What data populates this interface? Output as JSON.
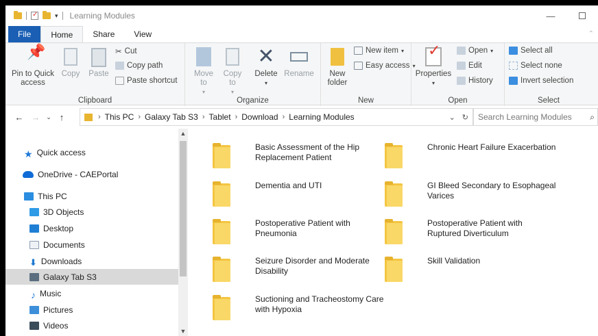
{
  "window": {
    "title": "Learning Modules",
    "controls": [
      "—",
      "☐"
    ]
  },
  "ribbon_tabs": [
    "File",
    "Home",
    "Share",
    "View"
  ],
  "clipboard": {
    "pin_label": "Pin to Quick access",
    "copy_label": "Copy",
    "paste_label": "Paste",
    "cut_label": "Cut",
    "copy_path_label": "Copy path",
    "paste_shortcut_label": "Paste shortcut",
    "group_label": "Clipboard"
  },
  "organize": {
    "move_to_label": "Move to",
    "copy_to_label": "Copy to",
    "delete_label": "Delete",
    "rename_label": "Rename",
    "group_label": "Organize"
  },
  "new_group": {
    "new_folder_label": "New folder",
    "new_item_label": "New item",
    "easy_access_label": "Easy access",
    "group_label": "New"
  },
  "open_group": {
    "properties_label": "Properties",
    "open_label": "Open",
    "edit_label": "Edit",
    "history_label": "History",
    "group_label": "Open"
  },
  "select_group": {
    "select_all_label": "Select all",
    "select_none_label": "Select none",
    "invert_label": "Invert selection",
    "group_label": "Select"
  },
  "address": {
    "crumbs": [
      "This PC",
      "Galaxy Tab S3",
      "Tablet",
      "Download",
      "Learning Modules"
    ]
  },
  "search": {
    "placeholder": "Search Learning Modules"
  },
  "sidebar": {
    "items": [
      {
        "label": "Quick access",
        "icon": "star-icon",
        "color": "#1e78d7"
      },
      {
        "label": "OneDrive - CAEPortal",
        "icon": "cloud-icon",
        "color": "#0f6cd6"
      },
      {
        "label": "This PC",
        "icon": "computer-icon",
        "color": "#2b8de0"
      },
      {
        "label": "3D Objects",
        "icon": "cube-icon",
        "color": "#2e9be6"
      },
      {
        "label": "Desktop",
        "icon": "desktop-icon",
        "color": "#1f7fd4"
      },
      {
        "label": "Documents",
        "icon": "documents-icon",
        "color": "#8a9bb0"
      },
      {
        "label": "Downloads",
        "icon": "download-icon",
        "color": "#1f79d2"
      },
      {
        "label": "Galaxy Tab S3",
        "icon": "device-icon",
        "color": "#5a6e80"
      },
      {
        "label": "Music",
        "icon": "music-icon",
        "color": "#2a7fd8"
      },
      {
        "label": "Pictures",
        "icon": "pictures-icon",
        "color": "#3d8fd9"
      },
      {
        "label": "Videos",
        "icon": "videos-icon",
        "color": "#3a4b5a"
      }
    ],
    "selected": "Galaxy Tab S3"
  },
  "folders": [
    "Basic Assessment of the Hip Replacement Patient",
    "Chronic Heart Failure Exacerbation",
    "Dementia and UTI",
    "GI Bleed Secondary to Esophageal Varices",
    "Postoperative Patient with Pneumonia",
    "Postoperative Patient with Ruptured Diverticulum",
    "Seizure Disorder and Moderate Disability",
    "Skill Validation",
    "Suctioning and Tracheostomy Care with Hypoxia"
  ]
}
